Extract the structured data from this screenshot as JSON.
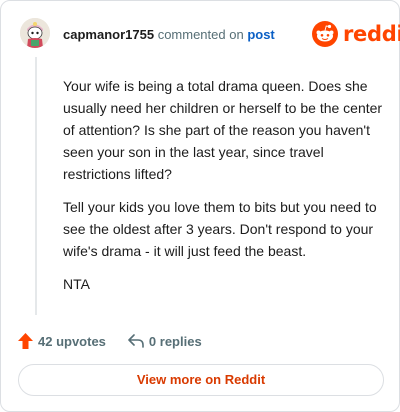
{
  "comment": {
    "username": "capmanor1755",
    "commented_text": "commented on",
    "post_link": "post",
    "paragraphs": [
      "Your wife is being a total drama queen. Does she usually need her children or herself to be the center of attention? Is she part of the reason you haven't seen your son in the last year, since travel restrictions lifted?",
      "Tell your kids you love them to bits but you need to see the oldest after 3 years. Don't respond to your wife's drama - it will just feed the beast.",
      "NTA"
    ]
  },
  "brand": {
    "name": "reddit",
    "icon": "reddit-logo-icon",
    "color": "#ff4500"
  },
  "actions": {
    "upvotes": "42 upvotes",
    "upvote_icon": "upvote-arrow-icon",
    "upvote_color": "#ff4500",
    "replies": "0 replies",
    "reply_icon": "reply-arrow-icon"
  },
  "view_more": {
    "label": "View more on Reddit",
    "color": "#d93a00"
  }
}
